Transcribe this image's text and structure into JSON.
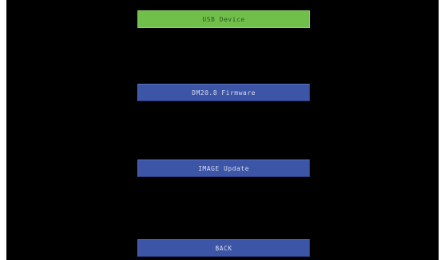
{
  "menu": {
    "usb_device_label": "USB Device",
    "firmware_label": "DM20.8 Firmware",
    "image_update_label": "IMAGE Update",
    "back_label": "BACK"
  },
  "colors": {
    "background": "#000000",
    "selected_button": "#6fbf4a",
    "button": "#3d55a6"
  }
}
